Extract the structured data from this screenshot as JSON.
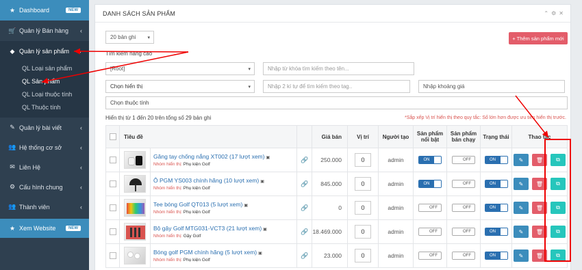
{
  "sidebar": {
    "items": [
      {
        "label": "Dashboard",
        "icon": "star-icon",
        "badge": "NEW"
      },
      {
        "label": "Quản lý Bán hàng",
        "icon": "cart-icon"
      },
      {
        "label": "Quản lý sản phẩm",
        "icon": "diamond-icon"
      },
      {
        "label": "Quản lý bài viết",
        "icon": "edit-icon"
      },
      {
        "label": "Hệ thống cơ sở",
        "icon": "users-icon"
      },
      {
        "label": "Liên Hệ",
        "icon": "mail-icon"
      },
      {
        "label": "Cấu hình chung",
        "icon": "gear-icon"
      },
      {
        "label": "Thành viên",
        "icon": "users-icon"
      },
      {
        "label": "Xem Website",
        "icon": "star-icon",
        "badge": "NEW"
      }
    ],
    "subitems": [
      "QL Loại sản phẩm",
      "QL Sản phẩm",
      "QL Loại thuộc tính",
      "QL Thuộc tính"
    ]
  },
  "panel": {
    "title": "DANH SÁCH SẢN PHẨM",
    "page_size": "20 bản ghi",
    "add_button": "+ Thêm sản phẩm mới",
    "search_label": "Tìm kiếm nâng cao",
    "filter_root": "[Root]",
    "keyword_placeholder": "Nhập từ khóa tìm kiếm theo tên...",
    "display_select": "Chọn hiển thị",
    "tag_placeholder": "Nhập 2 kí tự để tìm kiếm theo tag..",
    "price_placeholder": "Nhập khoảng giá",
    "attribute_select": "Chọn thuộc tính",
    "info": "Hiển thị từ 1 đến 20 trên tổng số 29 bản ghi",
    "note": "*Sắp xếp Vị trí hiển thị theo quy tắc: Số lớn hơn được ưu tiên hiển thị trước."
  },
  "table": {
    "headers": [
      "Tiêu đề",
      "Giá bán",
      "Vị trí",
      "Người tạo",
      "Sản phẩm nổi bật",
      "Sản phẩm bán chạy",
      "Trạng thái",
      "Thao tác"
    ],
    "cat_prefix": "Nhóm hiển thị:",
    "toggle_on": "ON",
    "toggle_off": "OFF",
    "rows": [
      {
        "title": "Găng tay chống nắng XT002 (17 lượt xem)",
        "cat": "Phụ kiện Golf",
        "price": "250.000",
        "pos": "0",
        "creator": "admin",
        "featured": "ON",
        "bestseller": "OFF",
        "status": "ON"
      },
      {
        "title": "Ô PGM YS003 chính hãng (10 lượt xem)",
        "cat": "Phụ kiện Golf",
        "price": "845.000",
        "pos": "0",
        "creator": "admin",
        "featured": "ON",
        "bestseller": "OFF",
        "status": "ON"
      },
      {
        "title": "Tee bóng Golf QT013 (5 lượt xem)",
        "cat": "Phụ kiện Golf",
        "price": "0",
        "pos": "0",
        "creator": "admin",
        "featured": "OFF",
        "bestseller": "OFF",
        "status": "ON"
      },
      {
        "title": "Bộ gậy Golf MTG031-VCT3 (21 lượt xem)",
        "cat": "Gậy Golf",
        "price": "18.469.000",
        "pos": "0",
        "creator": "admin",
        "featured": "OFF",
        "bestseller": "OFF",
        "status": "ON"
      },
      {
        "title": "Bóng golf PGM chính hãng (5 lượt xem)",
        "cat": "Phụ kiện Golf",
        "price": "23.000",
        "pos": "0",
        "creator": "admin",
        "featured": "OFF",
        "bestseller": "OFF",
        "status": "ON"
      }
    ]
  },
  "colors": {
    "sidebar_bg": "#2f4050",
    "accent": "#3c8dbc",
    "danger": "#e35d6a",
    "copy": "#26c6bc",
    "annotation": "#e00000"
  }
}
